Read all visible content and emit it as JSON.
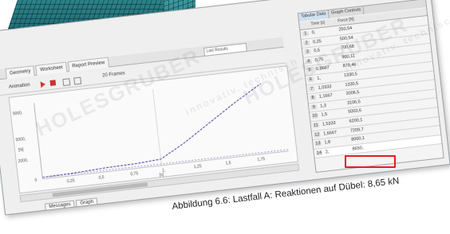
{
  "tabs": [
    "Geometry",
    "Worksheet",
    "Report Preview"
  ],
  "tab_dropdown": "Last Results",
  "toolbar": {
    "label": "Animation",
    "frames_label": "20 Frames"
  },
  "graph": {
    "y_ticks": [
      "9000,",
      "5000,",
      "2000,",
      "0"
    ],
    "x_ticks": [
      "0,25",
      "0,5",
      "0,75",
      "1,",
      "1,25",
      "1,5",
      "1,75"
    ],
    "x_unit": "[s]",
    "y_unit": "[N]"
  },
  "bottom_tabs": [
    "Messages",
    "Graph"
  ],
  "table": {
    "tabs": [
      "Tabular Data",
      "Graph Controls"
    ],
    "headers": [
      "Time [s]",
      "Force [N]"
    ],
    "rows": [
      [
        "1",
        "0,",
        "250,54"
      ],
      [
        "2",
        "0,25",
        "500,54"
      ],
      [
        "3",
        "0,5",
        "700,68"
      ],
      [
        "4",
        "0,75",
        "900,11"
      ],
      [
        "5",
        "0,8667",
        "878,46"
      ],
      [
        "6",
        "1,",
        "1330,5"
      ],
      [
        "7",
        "1,0333",
        "1330,5"
      ],
      [
        "8",
        "1,1667",
        "2006,5"
      ],
      [
        "9",
        "1,3",
        "3106,5"
      ],
      [
        "10",
        "1,5",
        "5003,6"
      ],
      [
        "11",
        "1,5333",
        "6200,1"
      ],
      [
        "12",
        "1,6667",
        "7209,7"
      ],
      [
        "13",
        "1,8",
        "8000,1"
      ],
      [
        "14",
        "2,",
        "8650,"
      ]
    ]
  },
  "caption": "Abbildung 6.6: Lastfall A: Reaktionen auf Dübel: 8,65 kN",
  "watermarks": [
    "HOLESGRUBER",
    "innovativ. technisch"
  ]
}
